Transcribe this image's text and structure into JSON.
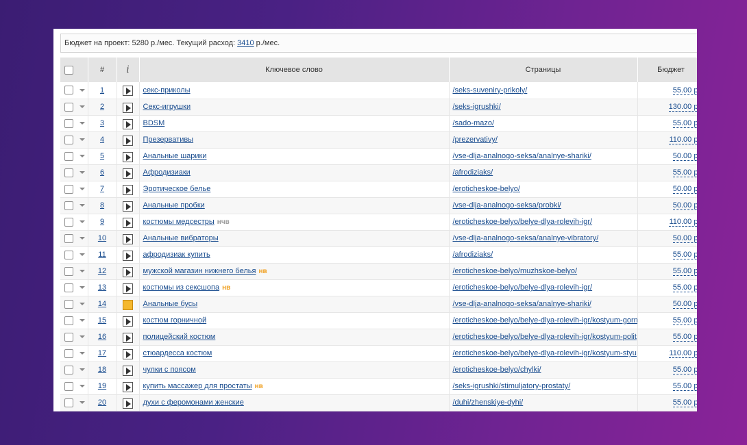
{
  "budget": {
    "text_before": "Бюджет на проект: 5280 р./мес. Текущий расход: ",
    "spend": "3410",
    "text_after": " р./мес."
  },
  "table": {
    "headers": {
      "num": "#",
      "info": "i",
      "keyword": "Ключевое слово",
      "pages": "Страницы",
      "budget": "Бюджет"
    },
    "rows": [
      {
        "num": "1",
        "keyword": "секс-приколы",
        "tag": "",
        "page": "/seks-suveniry-prikoly/",
        "budget": "55.00 р.",
        "state": "play"
      },
      {
        "num": "2",
        "keyword": "Секс-игрушки",
        "tag": "",
        "page": "/seks-igrushki/",
        "budget": "130.00 р.",
        "state": "play"
      },
      {
        "num": "3",
        "keyword": "BDSM",
        "tag": "",
        "page": "/sado-mazo/",
        "budget": "55.00 р.",
        "state": "play"
      },
      {
        "num": "4",
        "keyword": "Презервативы",
        "tag": "",
        "page": "/prezervativy/",
        "budget": "110.00 р.",
        "state": "play"
      },
      {
        "num": "5",
        "keyword": "Анальные шарики",
        "tag": "",
        "page": "/vse-dlja-analnogo-seksa/analnye-shariki/",
        "budget": "50.00 р.",
        "state": "play"
      },
      {
        "num": "6",
        "keyword": "Афродизиаки",
        "tag": "",
        "page": "/afrodiziaks/",
        "budget": "55.00 р.",
        "state": "play"
      },
      {
        "num": "7",
        "keyword": "Эротическое белье",
        "tag": "",
        "page": "/eroticheskoe-belyo/",
        "budget": "50.00 р.",
        "state": "play"
      },
      {
        "num": "8",
        "keyword": "Анальные пробки",
        "tag": "",
        "page": "/vse-dlja-analnogo-seksa/probki/",
        "budget": "50.00 р.",
        "state": "play"
      },
      {
        "num": "9",
        "keyword": "костюмы медсестры",
        "tag": "нчв",
        "tagColor": "gray",
        "page": "/eroticheskoe-belyo/belye-dlya-rolevih-igr/",
        "budget": "110.00 р.",
        "state": "play"
      },
      {
        "num": "10",
        "keyword": "Анальные вибраторы",
        "tag": "",
        "page": "/vse-dlja-analnogo-seksa/analnye-vibratory/",
        "budget": "50.00 р.",
        "state": "play"
      },
      {
        "num": "11",
        "keyword": "афродизиак купить",
        "tag": "",
        "page": "/afrodiziaks/",
        "budget": "55.00 р.",
        "state": "play"
      },
      {
        "num": "12",
        "keyword": "мужской магазин нижнего белья",
        "tag": "нв",
        "tagColor": "orange",
        "page": "/eroticheskoe-belyo/muzhskoe-belyo/",
        "budget": "55.00 р.",
        "state": "play"
      },
      {
        "num": "13",
        "keyword": "костюмы из сексшопа",
        "tag": "нв",
        "tagColor": "orange",
        "page": "/eroticheskoe-belyo/belye-dlya-rolevih-igr/",
        "budget": "55.00 р.",
        "state": "play"
      },
      {
        "num": "14",
        "keyword": "Анальные бусы",
        "tag": "",
        "page": "/vse-dlja-analnogo-seksa/analnye-shariki/",
        "budget": "50.00 р.",
        "state": "paused"
      },
      {
        "num": "15",
        "keyword": "костюм горничной",
        "tag": "",
        "page": "/eroticheskoe-belyo/belye-dlya-rolevih-igr/kostyum-gorn",
        "budget": "55.00 р.",
        "state": "play"
      },
      {
        "num": "16",
        "keyword": "полицейский костюм",
        "tag": "",
        "page": "/eroticheskoe-belyo/belye-dlya-rolevih-igr/kostyum-polit",
        "budget": "55.00 р.",
        "state": "play"
      },
      {
        "num": "17",
        "keyword": "стюардесса костюм",
        "tag": "",
        "page": "/eroticheskoe-belyo/belye-dlya-rolevih-igr/kostyum-styu",
        "budget": "110.00 р.",
        "state": "play"
      },
      {
        "num": "18",
        "keyword": "чулки с поясом",
        "tag": "",
        "page": "/eroticheskoe-belyo/chylki/",
        "budget": "55.00 р.",
        "state": "play"
      },
      {
        "num": "19",
        "keyword": "купить массажер для простаты",
        "tag": "нв",
        "tagColor": "orange",
        "page": "/seks-igrushki/stimuljatory-prostaty/",
        "budget": "55.00 р.",
        "state": "play"
      },
      {
        "num": "20",
        "keyword": "духи с феромонами женские",
        "tag": "",
        "page": "/duhi/zhenskiye-dyhi/",
        "budget": "55.00 р.",
        "state": "play"
      }
    ]
  }
}
